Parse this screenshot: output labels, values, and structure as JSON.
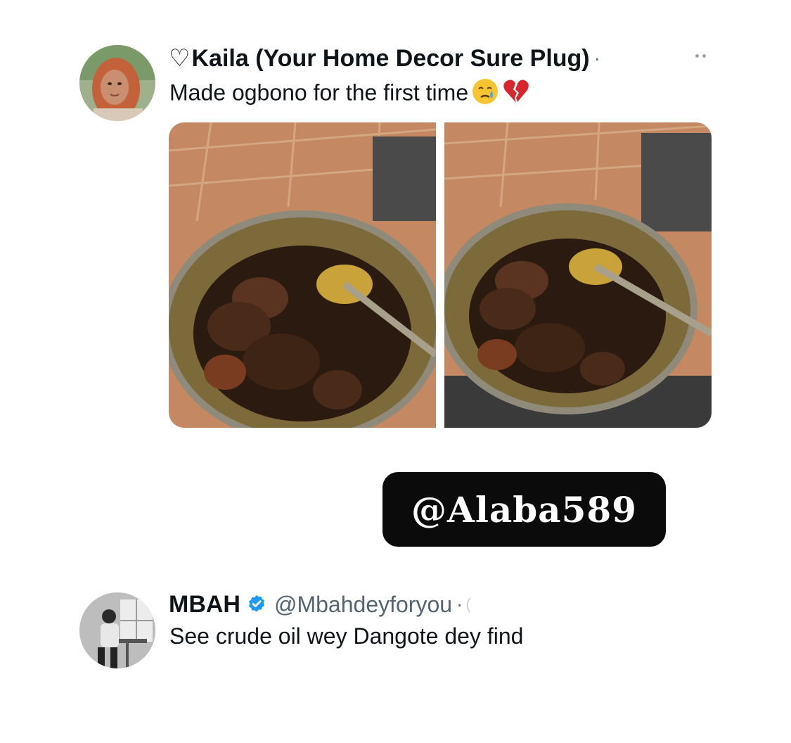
{
  "tweet1": {
    "heart": "♡",
    "display_name": "Kaila (Your Home Decor Sure Plug)",
    "separator": "·",
    "text": "Made ogbono for the first time",
    "emojis": [
      "crying-face-emoji",
      "broken-heart-emoji"
    ],
    "media_count": 2
  },
  "watermark": {
    "text": "@Alaba589"
  },
  "tweet2": {
    "display_name": "MBAH",
    "verified": true,
    "handle": "@Mbahdeyforyou",
    "separator": "·",
    "text": "See crude oil wey Dangote dey find"
  },
  "colors": {
    "text_primary": "#0f1419",
    "text_secondary": "#536471",
    "verified_blue": "#1d9bf0",
    "watermark_bg": "#0b0b0b"
  }
}
